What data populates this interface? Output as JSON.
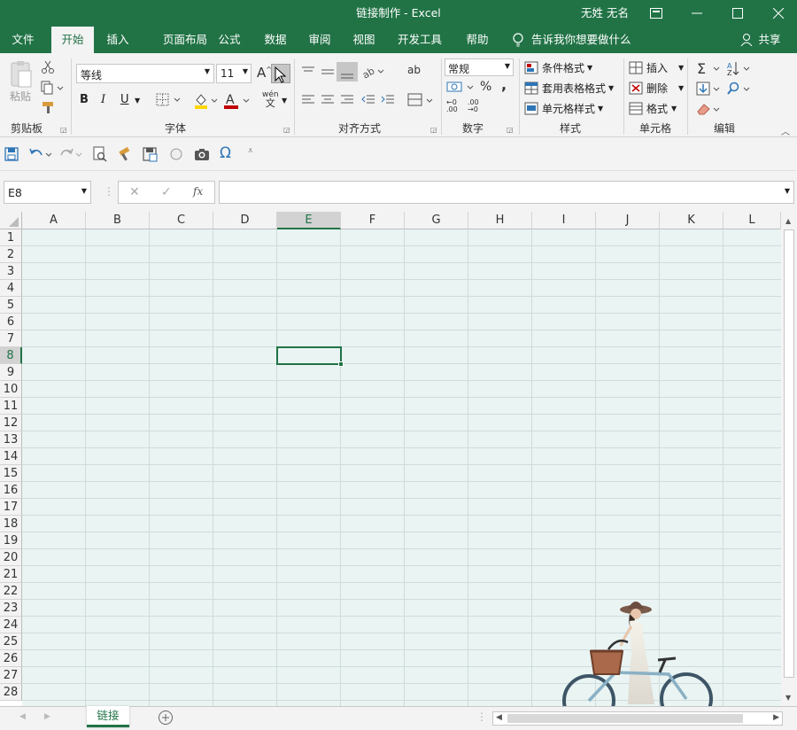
{
  "window": {
    "title": "链接制作  -  Excel",
    "user": "无姓 无名"
  },
  "menu": {
    "tabs": [
      "文件",
      "开始",
      "插入",
      "页面布局",
      "公式",
      "数据",
      "审阅",
      "视图",
      "开发工具",
      "帮助"
    ],
    "tell_me": "告诉我你想要做什么",
    "share": "共享"
  },
  "ribbon": {
    "clipboard": {
      "paste": "粘贴",
      "label": "剪贴板"
    },
    "font": {
      "name": "等线",
      "size": "11",
      "label": "字体",
      "bold": "B",
      "italic": "I",
      "underline": "U",
      "grow": "A",
      "pinyin_top": "wén",
      "pinyin_bottom": "文"
    },
    "alignment": {
      "label": "对齐方式",
      "wrap": "ab"
    },
    "number": {
      "format": "常规",
      "label": "数字",
      "percent": "%",
      "comma": ",",
      "inc_decimal": ".00",
      "dec_decimal": ".00"
    },
    "styles": {
      "conditional": "条件格式",
      "table": "套用表格格式",
      "cell": "单元格样式",
      "label": "样式"
    },
    "cells": {
      "insert": "插入",
      "delete": "删除",
      "format": "格式",
      "label": "单元格"
    },
    "editing": {
      "label": "编辑"
    }
  },
  "formula_bar": {
    "name_box": "E8",
    "value": "",
    "fx": "fx"
  },
  "grid": {
    "columns": [
      "A",
      "B",
      "C",
      "D",
      "E",
      "F",
      "G",
      "H",
      "I",
      "J",
      "K",
      "L"
    ],
    "rows": [
      "1",
      "2",
      "3",
      "4",
      "5",
      "6",
      "7",
      "8",
      "9",
      "10",
      "11",
      "12",
      "13",
      "14",
      "15",
      "16",
      "17",
      "18",
      "19",
      "20",
      "21",
      "22",
      "23",
      "24",
      "25",
      "26",
      "27",
      "28"
    ],
    "active_cell": "E8"
  },
  "sheets": {
    "tabs": [
      "链接"
    ],
    "active": "链接"
  },
  "colors": {
    "brand": "#217346",
    "ribbon_bg": "#f3f3f3",
    "cell_bg": "#e9f4f3"
  }
}
